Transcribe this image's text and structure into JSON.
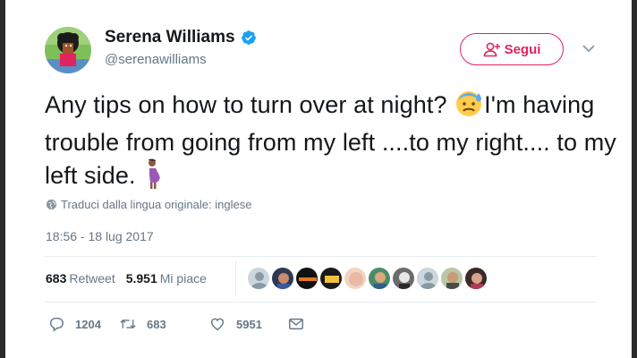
{
  "author": {
    "name": "Serena Williams",
    "handle": "@serenawilliams",
    "verified": true
  },
  "follow_button": {
    "label": "Segui",
    "accent": "#e0245e"
  },
  "tweet": {
    "text_before_emoji": "Any tips on how to turn over at night? ",
    "emoji_1": "anxious-sweat-face",
    "text_after_emoji": "I'm having trouble from going from my left ....to my right.... to my left side. ",
    "emoji_2": "pregnant-woman"
  },
  "translate_label": "Traduci dalla lingua originale: inglese",
  "timestamp": "18:56 - 18 lug 2017",
  "stats": {
    "retweets_count": "683",
    "retweets_label": "Retweet",
    "likes_count": "5.951",
    "likes_label": "Mi piace"
  },
  "actions": {
    "replies": "1204",
    "retweets": "683",
    "likes": "5951"
  },
  "colors": {
    "text": "#14171a",
    "secondary": "#657786",
    "verified": "#1da1f2",
    "divider": "#e6ecf0"
  }
}
